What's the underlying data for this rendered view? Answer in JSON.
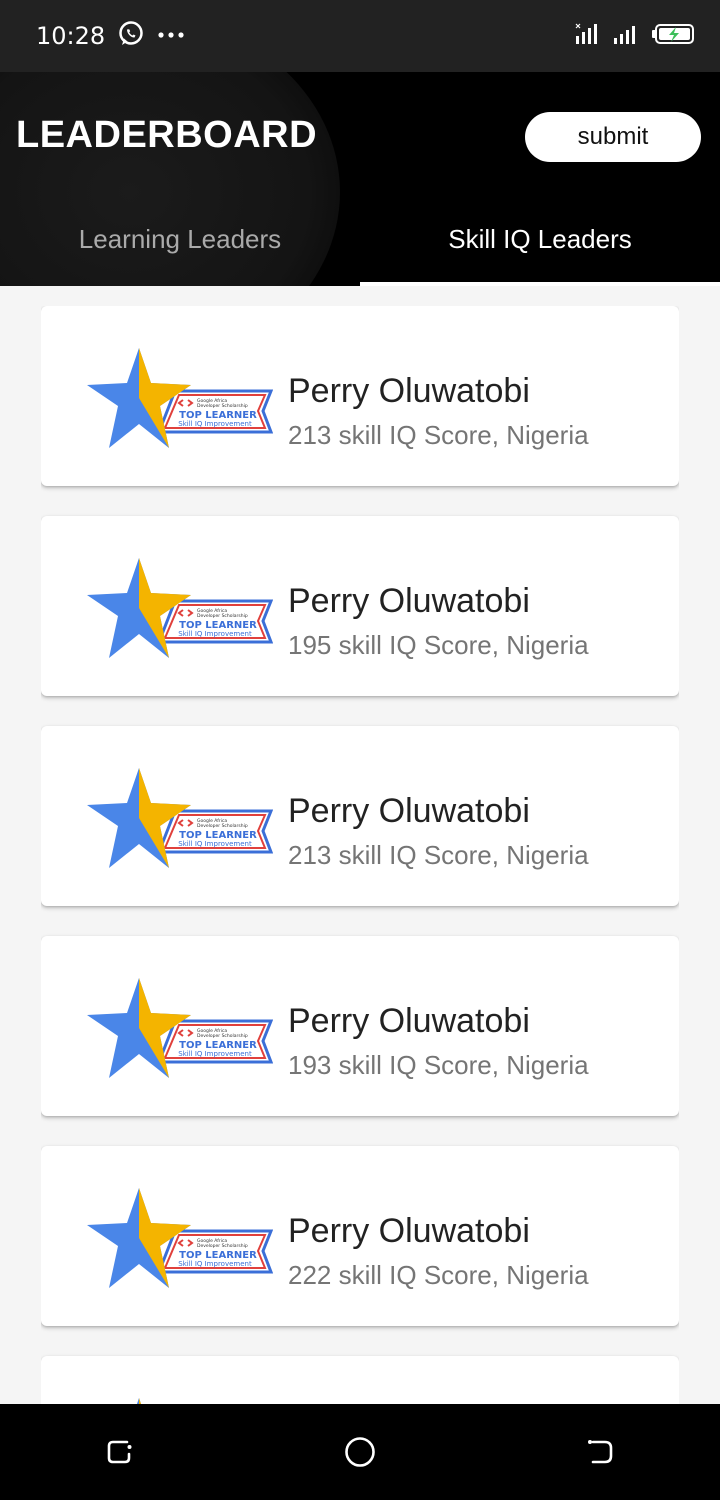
{
  "status_bar": {
    "time": "10:28",
    "icons": [
      "whatsapp-icon",
      "more-dots-icon",
      "signal-icon",
      "signal-icon",
      "battery-charging-icon"
    ]
  },
  "app_bar": {
    "title": "LEADERBOARD",
    "submit_label": "submit"
  },
  "tabs": [
    {
      "label": "Learning Leaders",
      "active": false
    },
    {
      "label": "Skill IQ Leaders",
      "active": true
    }
  ],
  "badge": {
    "line1": "Google Africa",
    "line2": "Developer Scholarship",
    "title": "TOP LEARNER",
    "subtitle": "Skill IQ Improvement"
  },
  "leaders": [
    {
      "name": "Perry Oluwatobi",
      "detail": "213 skill IQ Score, Nigeria"
    },
    {
      "name": "Perry Oluwatobi",
      "detail": "195 skill IQ Score, Nigeria"
    },
    {
      "name": "Perry Oluwatobi",
      "detail": "213 skill IQ Score, Nigeria"
    },
    {
      "name": "Perry Oluwatobi",
      "detail": "193 skill IQ Score, Nigeria"
    },
    {
      "name": "Perry Oluwatobi",
      "detail": "222 skill IQ Score, Nigeria"
    },
    {
      "name": "",
      "detail": ""
    }
  ],
  "colors": {
    "star_blue": "#4a86e8",
    "star_yellow": "#f4b400",
    "ribbon_red": "#e0403c",
    "ribbon_blue": "#3b6fd8"
  },
  "nav": [
    "recent-apps-icon",
    "home-icon",
    "back-icon"
  ]
}
